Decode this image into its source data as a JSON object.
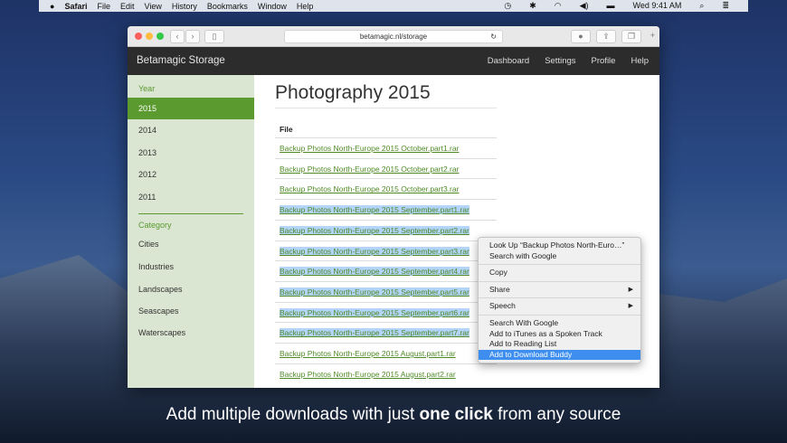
{
  "menubar": {
    "app": "Safari",
    "items": [
      "File",
      "Edit",
      "View",
      "History",
      "Bookmarks",
      "Window",
      "Help"
    ],
    "clock": "Wed 9:41 AM"
  },
  "browser": {
    "url": "betamagic.nl/storage"
  },
  "site": {
    "brand": "Betamagic Storage",
    "nav": [
      "Dashboard",
      "Settings",
      "Profile",
      "Help"
    ]
  },
  "sidebar": {
    "year_heading": "Year",
    "years": [
      "2015",
      "2014",
      "2013",
      "2012",
      "2011"
    ],
    "selected_year": "2015",
    "category_heading": "Category",
    "categories": [
      "Cities",
      "Industries",
      "Landscapes",
      "Seascapes",
      "Waterscapes"
    ]
  },
  "main": {
    "title": "Photography 2015",
    "column_header": "File",
    "files": [
      "Backup Photos North-Europe 2015 October.part1.rar",
      "Backup Photos North-Europe 2015 October.part2.rar",
      "Backup Photos North-Europe 2015 October.part3.rar",
      "Backup Photos North-Europe 2015 September.part1.rar",
      "Backup Photos North-Europe 2015 September.part2.rar",
      "Backup Photos North-Europe 2015 September.part3.rar",
      "Backup Photos North-Europe 2015 September.part4.rar",
      "Backup Photos North-Europe 2015 September.part5.rar",
      "Backup Photos North-Europe 2015 September.part6.rar",
      "Backup Photos North-Europe 2015 September.part7.rar",
      "Backup Photos North-Europe 2015 August.part1.rar",
      "Backup Photos North-Europe 2015 August.part2.rar"
    ]
  },
  "context_menu": {
    "lookup": "Look Up “Backup Photos North-Euro…”",
    "search_google": "Search with Google",
    "copy": "Copy",
    "share": "Share",
    "speech": "Speech",
    "search_with_google": "Search With Google",
    "itunes": "Add to iTunes as a Spoken Track",
    "reading_list": "Add to Reading List",
    "download_buddy": "Add to Download Buddy"
  },
  "caption": {
    "pre": "Add multiple downloads with just ",
    "bold": "one click",
    "post": " from any source"
  },
  "colors": {
    "accent": "#5a9a2f",
    "selection": "#b3d4fb",
    "menu_highlight": "#3e8ef0"
  }
}
